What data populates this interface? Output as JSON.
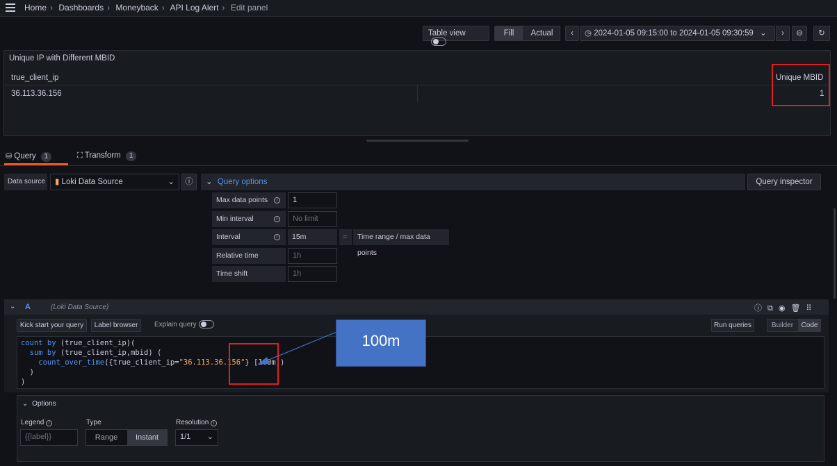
{
  "breadcrumb": [
    "Home",
    "Dashboards",
    "Moneyback",
    "API Log Alert",
    "Edit panel"
  ],
  "toolbar": {
    "table_view": "Table view",
    "fill": "Fill",
    "actual": "Actual",
    "time_range": "2024-01-05 09:15:00 to 2024-01-05 09:30:59"
  },
  "panel": {
    "title": "Unique IP with Different MBID",
    "columns": [
      "true_client_ip",
      "Unique MBID"
    ],
    "rows": [
      [
        "36.113.36.156",
        "1"
      ]
    ]
  },
  "tabs": [
    {
      "label": "Query",
      "count": "1"
    },
    {
      "label": "Transform",
      "count": "1"
    }
  ],
  "datasource": {
    "label": "Data source",
    "name": "Loki Data Source",
    "query_options": "Query options",
    "inspector": "Query inspector"
  },
  "query_options": {
    "max_data_points": {
      "label": "Max data points",
      "value": "1"
    },
    "min_interval": {
      "label": "Min interval",
      "placeholder": "No limit"
    },
    "interval": {
      "label": "Interval",
      "value": "15m",
      "eq": "=",
      "note": "Time range / max data points"
    },
    "relative_time": {
      "label": "Relative time",
      "placeholder": "1h"
    },
    "time_shift": {
      "label": "Time shift",
      "placeholder": "1h"
    }
  },
  "query_row": {
    "ref": "A",
    "source": "(Loki Data Source)",
    "kick_start": "Kick start your query",
    "label_browser": "Label browser",
    "explain": "Explain query",
    "run": "Run queries",
    "builder": "Builder",
    "code": "Code"
  },
  "code_lines": {
    "l1a": "count by",
    "l1b": " (true_client_ip)(",
    "l2a": "  sum by",
    "l2b": " (true_client_ip,mbid) (",
    "l3a": "    count_over_time",
    "l3b": "({true_client_ip=",
    "l3c": "\"36.113.36.156\"",
    "l3d": "} [100m])",
    "l4": "  )",
    "l5": ")"
  },
  "annotation": "100m",
  "options": {
    "title": "Options",
    "legend_label": "Legend",
    "legend_placeholder": "{{label}}",
    "type_label": "Type",
    "type_range": "Range",
    "type_instant": "Instant",
    "resolution_label": "Resolution",
    "resolution_value": "1/1"
  },
  "colors": {
    "accent": "#5794f2",
    "annotation_fill": "#4472c4",
    "highlight": "#e21f1f",
    "tab_underline": "#f05a28"
  }
}
